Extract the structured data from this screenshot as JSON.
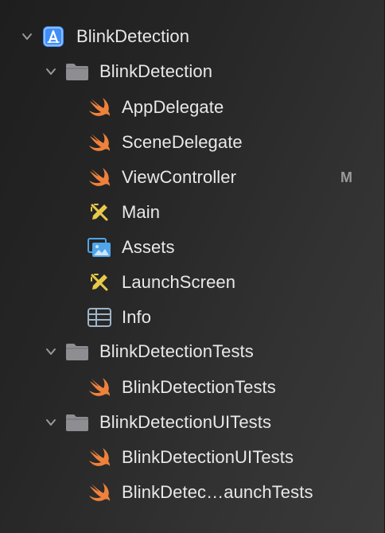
{
  "navigator": {
    "project": {
      "label": "BlinkDetection",
      "icon": "xcode-project-icon",
      "expanded": true
    },
    "groups": [
      {
        "label": "BlinkDetection",
        "icon": "folder-icon",
        "expanded": true,
        "files": [
          {
            "label": "AppDelegate",
            "icon": "swift-file-icon",
            "badge": ""
          },
          {
            "label": "SceneDelegate",
            "icon": "swift-file-icon",
            "badge": ""
          },
          {
            "label": "ViewController",
            "icon": "swift-file-icon",
            "badge": "M"
          },
          {
            "label": "Main",
            "icon": "storyboard-icon",
            "badge": ""
          },
          {
            "label": "Assets",
            "icon": "asset-catalog-icon",
            "badge": ""
          },
          {
            "label": "LaunchScreen",
            "icon": "storyboard-icon",
            "badge": ""
          },
          {
            "label": "Info",
            "icon": "plist-table-icon",
            "badge": ""
          }
        ]
      },
      {
        "label": "BlinkDetectionTests",
        "icon": "folder-icon",
        "expanded": true,
        "files": [
          {
            "label": "BlinkDetectionTests",
            "icon": "swift-file-icon",
            "badge": ""
          }
        ]
      },
      {
        "label": "BlinkDetectionUITests",
        "icon": "folder-icon",
        "expanded": true,
        "files": [
          {
            "label": "BlinkDetectionUITests",
            "icon": "swift-file-icon",
            "badge": ""
          },
          {
            "label": "BlinkDetec…aunchTests",
            "icon": "swift-file-icon",
            "badge": ""
          }
        ]
      }
    ]
  },
  "colors": {
    "swift": "#f0813b",
    "storyboard": "#e8c84a",
    "folder": "#8d8d92",
    "project_blue": "#3f8ef7",
    "assets_blue": "#4fa5e8",
    "plist": "#9fb4c7",
    "text": "#e8e8e8",
    "badge": "#9a9a9a"
  }
}
